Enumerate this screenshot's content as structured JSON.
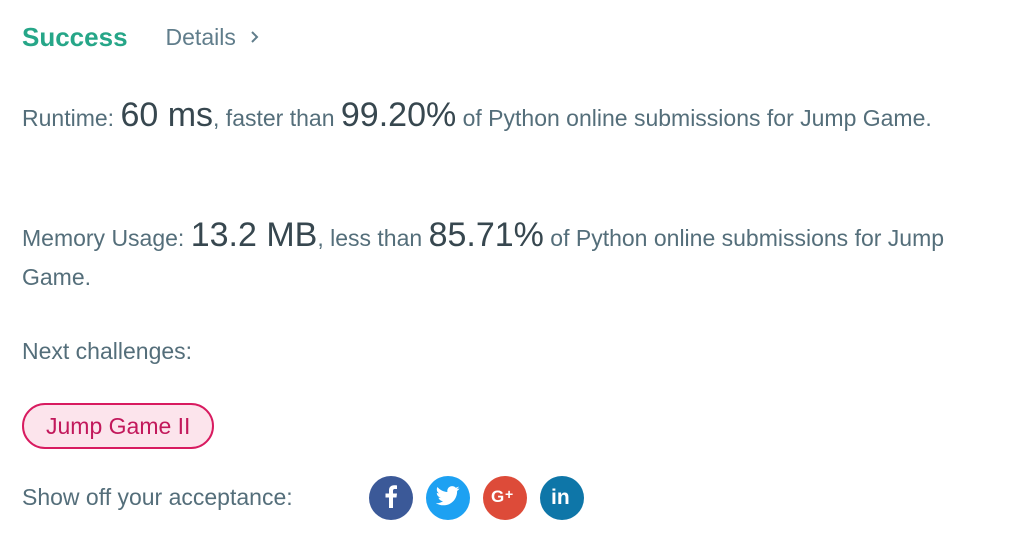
{
  "header": {
    "status": "Success",
    "details_label": "Details"
  },
  "runtime": {
    "label": "Runtime: ",
    "value": "60 ms",
    "comparison": ", faster than ",
    "percent": "99.20%",
    "suffix": " of Python online submissions for Jump Game."
  },
  "memory": {
    "label": "Memory Usage: ",
    "value": "13.2 MB",
    "comparison": ", less than ",
    "percent": "85.71%",
    "suffix": " of Python online submissions for Jump Game."
  },
  "next_challenges": {
    "label": "Next challenges:",
    "items": [
      {
        "label": "Jump Game II"
      }
    ]
  },
  "share": {
    "label": "Show off your acceptance:",
    "buttons": [
      {
        "icon": "facebook-icon",
        "glyph": "f",
        "color": "#3b5998"
      },
      {
        "icon": "twitter-icon",
        "glyph": "t",
        "color": "#1da1f2"
      },
      {
        "icon": "google-plus-icon",
        "glyph": "G+",
        "color": "#dd4b39"
      },
      {
        "icon": "linkedin-icon",
        "glyph": "in",
        "color": "#0e76a8"
      }
    ]
  },
  "colors": {
    "success": "#26a688",
    "chip_border": "#d81b60",
    "chip_bg": "#fce4ec"
  }
}
